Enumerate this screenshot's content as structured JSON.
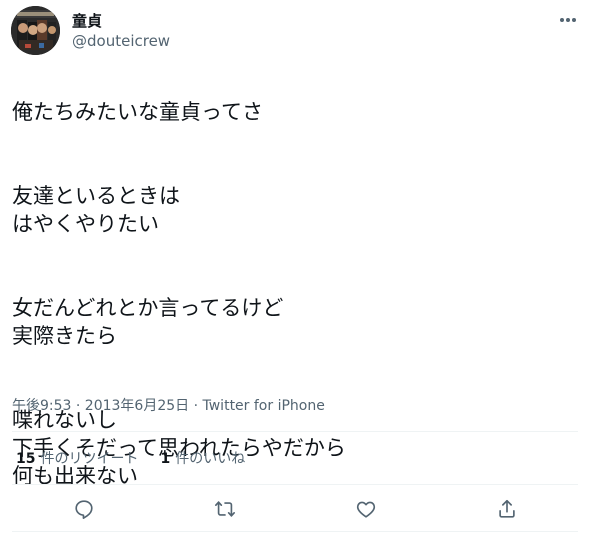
{
  "author": {
    "display_name": "童貞",
    "handle": "@douteicrew",
    "avatar_icon": "avatar-image"
  },
  "tweet": {
    "paragraphs": [
      "俺たちみたいな童貞ってさ",
      "友達といるときは\nはやくやりたい",
      "女だんどれとか言ってるけど\n実際きたら",
      "喋れないし\n下手くそだって思われたらやだから\n何も出来ない"
    ]
  },
  "meta": {
    "timestamp": "午後9:53 · 2013年6月25日",
    "separator": " · ",
    "source": "Twitter for iPhone"
  },
  "stats": {
    "retweets_count": "15",
    "retweets_label": "件のリツイート",
    "likes_count": "1",
    "likes_label": "件のいいね"
  },
  "icons": {
    "more": "more-icon",
    "reply": "reply-icon",
    "retweet": "retweet-icon",
    "like": "like-icon",
    "share": "share-icon"
  },
  "colors": {
    "text_primary": "#0f1419",
    "text_secondary": "#536471",
    "divider": "#eff3f4"
  }
}
